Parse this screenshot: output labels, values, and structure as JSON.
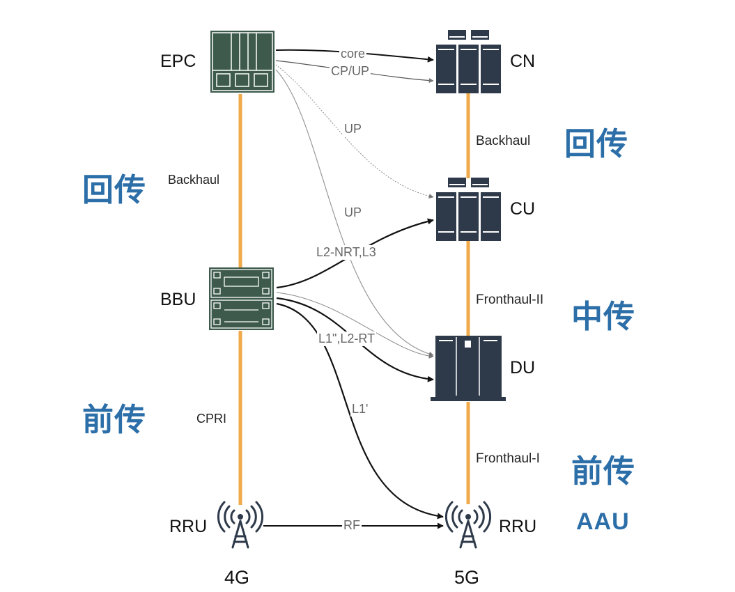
{
  "nodes_4g": {
    "epc": "EPC",
    "bbu": "BBU",
    "rru": "RRU"
  },
  "nodes_5g": {
    "cn": "CN",
    "cu": "CU",
    "du": "DU",
    "rru": "RRU"
  },
  "generations": {
    "g4": "4G",
    "g5": "5G"
  },
  "links_4g": {
    "backhaul": "Backhaul",
    "cpri": "CPRI"
  },
  "links_5g": {
    "backhaul": "Backhaul",
    "fronthaul_ii": "Fronthaul-II",
    "fronthaul_i": "Fronthaul-I"
  },
  "zones_4g": {
    "backhaul": "回传",
    "fronthaul": "前传"
  },
  "zones_5g": {
    "backhaul": "回传",
    "midhaul": "中传",
    "fronthaul": "前传",
    "aau": "AAU"
  },
  "arrows": {
    "core": "core",
    "cp_up": "CP/UP",
    "up_1": "UP",
    "up_2": "UP",
    "l2nrt_l3": "L2-NRT,L3",
    "l1_l2rt": "L1\",L2-RT",
    "l1": "L1'",
    "rf": "RF"
  },
  "colors": {
    "link": "#f0aa4a",
    "icon_dark": "#2e3a4a",
    "icon_green": "#3d5a4c",
    "zone_text": "#2b6ea8"
  }
}
